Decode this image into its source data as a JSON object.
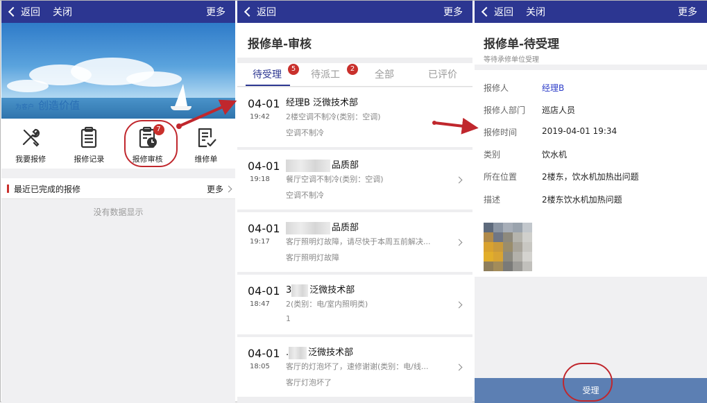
{
  "colors": {
    "nav": "#2c3691",
    "accent": "#c9302c",
    "footer": "#5c7fb3",
    "link": "#2c3cc8"
  },
  "panel1": {
    "nav": {
      "back": "返回",
      "close": "关闭",
      "more": "更多"
    },
    "banner": {
      "slogan_small": "为客户",
      "slogan_large": "创造价值"
    },
    "grid": [
      {
        "label": "我要报修",
        "icon": "wrench-screwdriver-icon"
      },
      {
        "label": "报修记录",
        "icon": "clipboard-list-icon"
      },
      {
        "label": "报修审核",
        "icon": "clipboard-clock-icon",
        "badge": "7"
      },
      {
        "label": "维修单",
        "icon": "document-check-icon"
      }
    ],
    "section": {
      "title": "最近已完成的报修",
      "more": "更多"
    },
    "empty": "没有数据显示"
  },
  "panel2": {
    "nav": {
      "back": "返回",
      "more": "更多"
    },
    "title": "报修单-审核",
    "tabs": [
      {
        "label": "待受理",
        "badge": "5"
      },
      {
        "label": "待派工",
        "badge": "2"
      },
      {
        "label": "全部"
      },
      {
        "label": "已评价"
      }
    ],
    "items": [
      {
        "date": "04-01",
        "time": "19:42",
        "title": "经理B 泛微技术部",
        "desc": "2楼空调不制冷(类别：空调)",
        "sub": "空调不制冷"
      },
      {
        "date": "04-01",
        "time": "19:18",
        "title": "品质部",
        "desc": "餐厅空调不制冷(类别：空调)",
        "sub": "空调不制冷"
      },
      {
        "date": "04-01",
        "time": "19:17",
        "title": "品质部",
        "desc": "客厅照明灯故障，请尽快于本周五前解决...",
        "sub": "客厅照明灯故障"
      },
      {
        "date": "04-01",
        "time": "18:47",
        "title": "泛微技术部",
        "title_prefix": "3",
        "desc": "(类别：电/室内照明类)",
        "desc_prefix": "2",
        "sub": "1"
      },
      {
        "date": "04-01",
        "time": "18:05",
        "title": "泛微技术部",
        "title_prefix": ".",
        "desc": "客厅的灯泡坏了，速修谢谢(类别：电/线...",
        "sub": "客厅灯泡坏了"
      }
    ]
  },
  "panel3": {
    "nav": {
      "back": "返回",
      "close": "关闭",
      "more": "更多"
    },
    "title": "报修单-待受理",
    "subtitle": "等待承修单位受理",
    "fields": [
      {
        "key": "报修人",
        "value": "经理B"
      },
      {
        "key": "报修人部门",
        "value": "巡店人员"
      },
      {
        "key": "报修时间",
        "value": "2019-04-01 19:34"
      },
      {
        "key": "类别",
        "value": "饮水机"
      },
      {
        "key": "所在位置",
        "value": "2楼东，饮水机加热出问题"
      },
      {
        "key": "描述",
        "value": "2楼东饮水机加热问题"
      }
    ],
    "accept": "受理"
  }
}
